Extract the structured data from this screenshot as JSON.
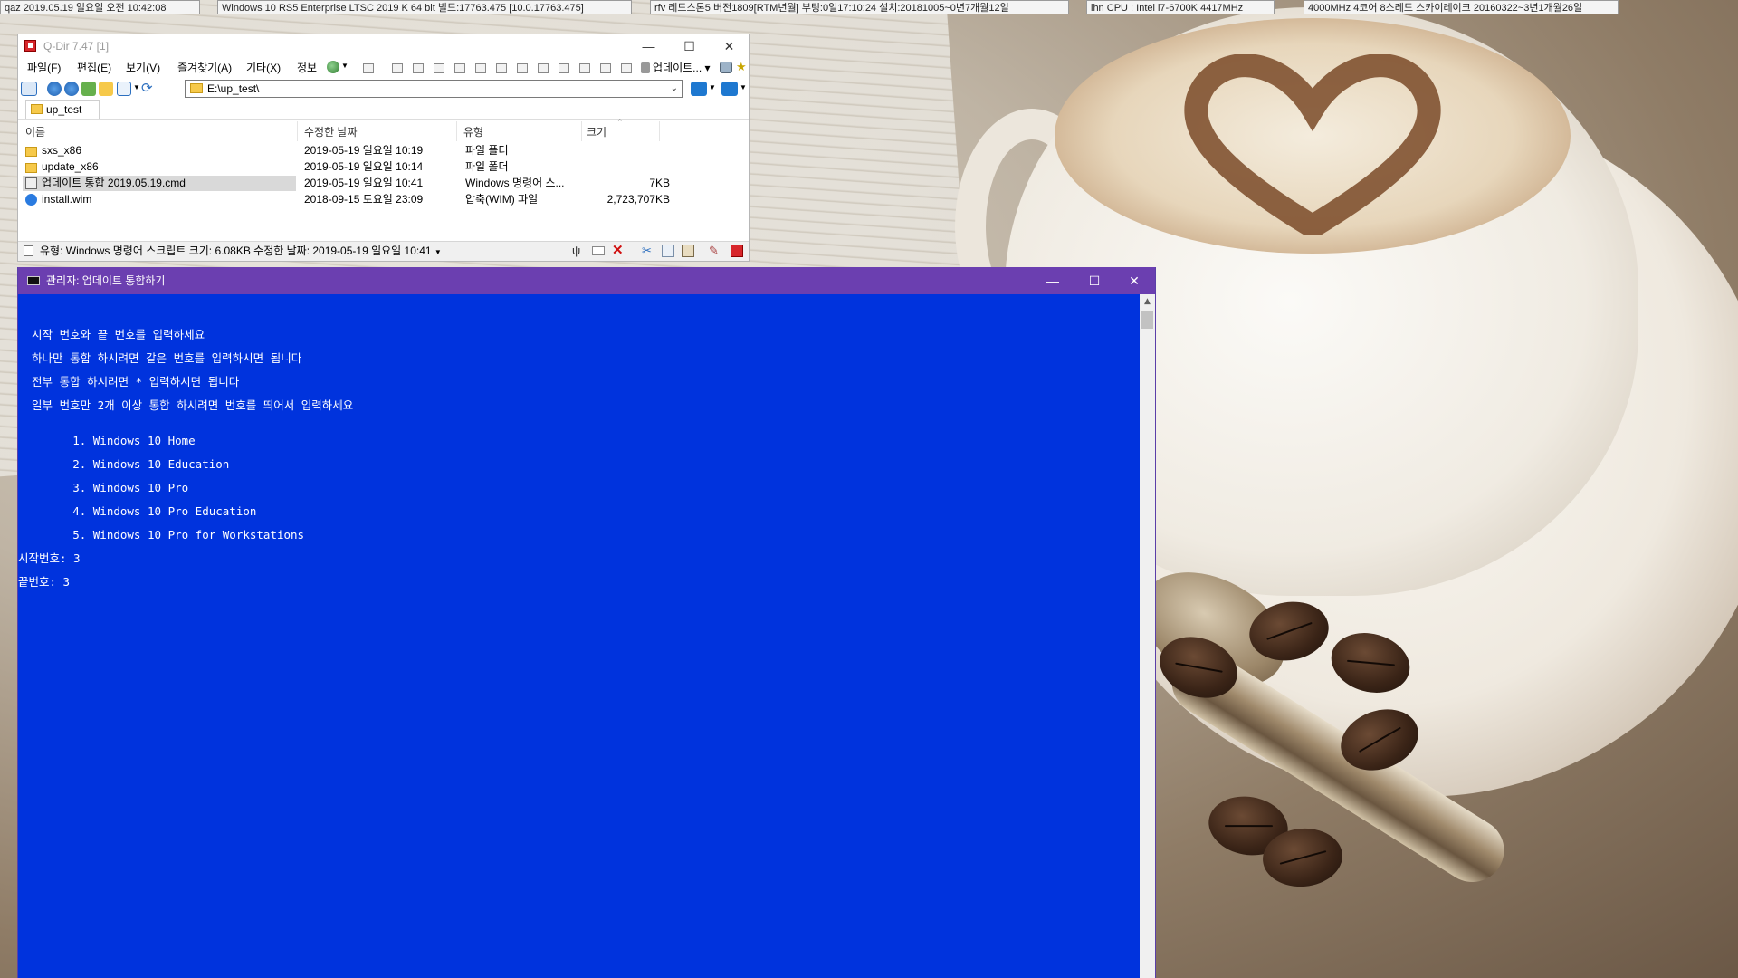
{
  "topbar": {
    "items": [
      {
        "label": "qaz",
        "value": "2019.05.19 일요일 오전 10:42:08"
      },
      {
        "value": "Windows 10 RS5 Enterprise LTSC 2019 K 64 bit 빌드:17763.475 [10.0.17763.475]"
      },
      {
        "label": "rfv",
        "value": "레드스톤5 버전1809[RTM년월] 부팅:0일17:10:24 설치:20181005~0년7개월12일"
      },
      {
        "label": "ihn",
        "value": "CPU : Intel i7-6700K 4417MHz"
      },
      {
        "value": "4000MHz 4코어 8스레드 스카이레이크 20160322~3년1개월26일"
      }
    ]
  },
  "qdir": {
    "title": "Q-Dir 7.47 [1]",
    "menu": [
      "파일(F)",
      "편집(E)",
      "보기(V)",
      "즐겨찾기(A)",
      "기타(X)",
      "정보"
    ],
    "update_label": "업데이트...",
    "address": "E:\\up_test\\",
    "tab": "up_test",
    "columns": [
      "이름",
      "수정한 날짜",
      "유형",
      "크기"
    ],
    "files": [
      {
        "name": "sxs_x86",
        "date": "2019-05-19 일요일 10:19",
        "type": "파일 폴더",
        "size": "",
        "icon": "folder-icon"
      },
      {
        "name": "update_x86",
        "date": "2019-05-19 일요일 10:14",
        "type": "파일 폴더",
        "size": "",
        "icon": "folder-icon"
      },
      {
        "name": "업데이트 통합 2019.05.19.cmd",
        "date": "2019-05-19 일요일 10:41",
        "type": "Windows 명령어 스...",
        "size": "7KB",
        "icon": "cmd-file-icon"
      },
      {
        "name": "install.wim",
        "date": "2018-09-15 토요일 23:09",
        "type": "압축(WIM) 파일",
        "size": "2,723,707KB",
        "icon": "wim-file-icon"
      }
    ],
    "status": "유형: Windows 명령어 스크립트 크기: 6.08KB 수정한 날짜: 2019-05-19 일요일 10:41"
  },
  "cmd": {
    "title": "관리자:  업데이트 통합하기",
    "lines": [
      "  시작 번호와 끝 번호를 입력하세요",
      "  하나만 통합 하시려면 같은 번호를 입력하시면 됩니다",
      "  전부 통합 하시려면 * 입력하시면 됩니다",
      "  일부 번호만 2개 이상 통합 하시려면 번호를 띄어서 입력하세요",
      "        1. Windows 10 Home",
      "        2. Windows 10 Education",
      "        3. Windows 10 Pro",
      "        4. Windows 10 Pro Education",
      "        5. Windows 10 Pro for Workstations",
      "시작번호: 3",
      "끝번호: 3"
    ]
  },
  "colors": {
    "cmd_background": "#0033dd",
    "cmd_titlebar": "#6b3fb0",
    "console_text": "#ffffff"
  }
}
